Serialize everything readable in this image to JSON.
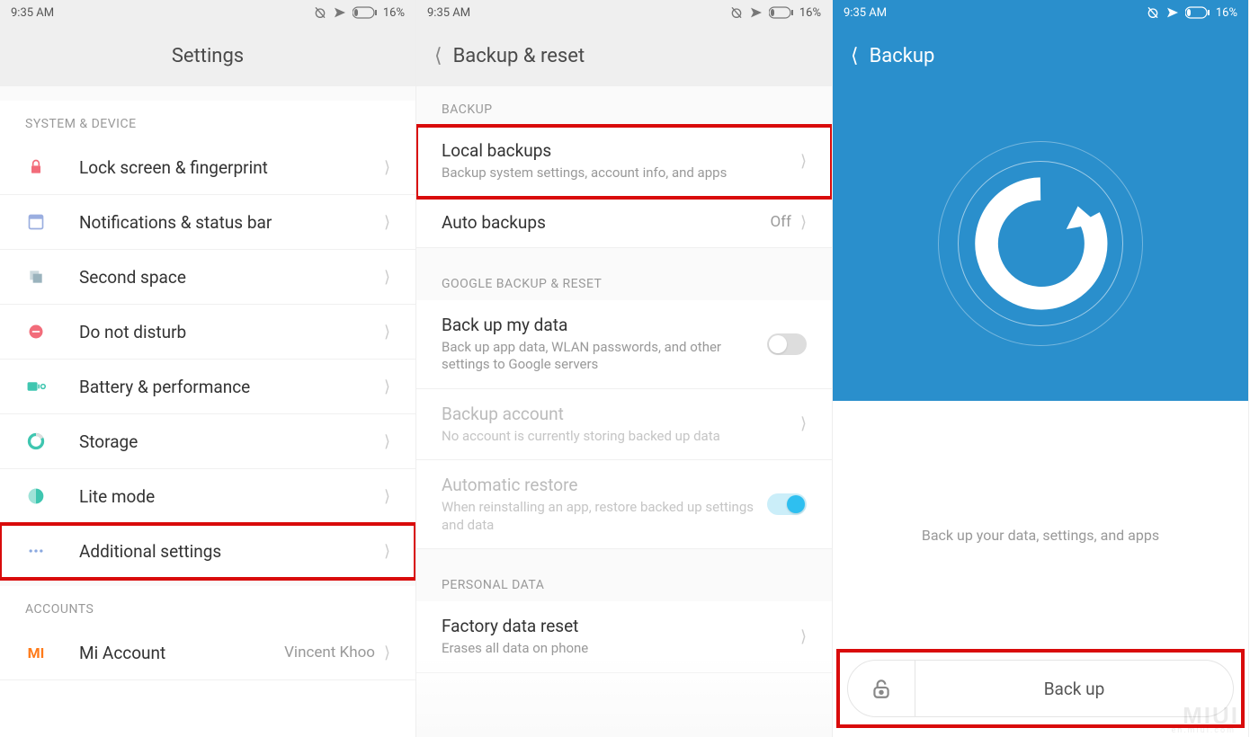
{
  "status": {
    "time": "9:35 AM",
    "battery": "16%"
  },
  "screen1": {
    "title": "Settings",
    "sections": [
      {
        "header": "SYSTEM & DEVICE",
        "items": [
          {
            "label": "Lock screen & fingerprint",
            "icon": "lock",
            "icon_color": "#f26c7a"
          },
          {
            "label": "Notifications & status bar",
            "icon": "statusbar",
            "icon_color": "#9aaee0"
          },
          {
            "label": "Second space",
            "icon": "space",
            "icon_color": "#9ab3bd"
          },
          {
            "label": "Do not disturb",
            "icon": "dnd",
            "icon_color": "#f26c7a"
          },
          {
            "label": "Battery & performance",
            "icon": "battery",
            "icon_color": "#3fc6b0"
          },
          {
            "label": "Storage",
            "icon": "storage",
            "icon_color": "#3fc6b0"
          },
          {
            "label": "Lite mode",
            "icon": "lite",
            "icon_color": "#3fc6b0"
          },
          {
            "label": "Additional settings",
            "icon": "more",
            "icon_color": "#8aa8e0",
            "highlighted": true
          }
        ]
      },
      {
        "header": "ACCOUNTS",
        "items": [
          {
            "label": "Mi Account",
            "icon": "mi",
            "icon_color": "#ff7b1a",
            "value": "Vincent Khoo"
          }
        ]
      }
    ]
  },
  "screen2": {
    "title": "Backup & reset",
    "sections": [
      {
        "header": "BACKUP",
        "items": [
          {
            "title": "Local backups",
            "subtitle": "Backup system settings, account info, and apps",
            "highlighted": true,
            "chevron": true
          },
          {
            "title": "Auto backups",
            "value": "Off",
            "chevron": true
          }
        ]
      },
      {
        "header": "GOOGLE BACKUP & RESET",
        "items": [
          {
            "title": "Back up my data",
            "subtitle": "Back up app data, WLAN passwords, and other settings to Google servers",
            "toggle": "off"
          },
          {
            "title": "Backup account",
            "subtitle": "No account is currently storing backed up data",
            "disabled": true,
            "chevron": true
          },
          {
            "title": "Automatic restore",
            "subtitle": "When reinstalling an app, restore backed up settings and data",
            "disabled": true,
            "toggle": "on"
          }
        ]
      },
      {
        "header": "PERSONAL DATA",
        "items": [
          {
            "title": "Factory data reset",
            "subtitle": "Erases all data on phone",
            "chevron": true
          }
        ]
      }
    ]
  },
  "screen3": {
    "title": "Backup",
    "message": "Back up your data, settings, and apps",
    "button": "Back up",
    "highlighted": true
  },
  "watermark": "MIUI",
  "watermark_sub": "en.miui.com"
}
